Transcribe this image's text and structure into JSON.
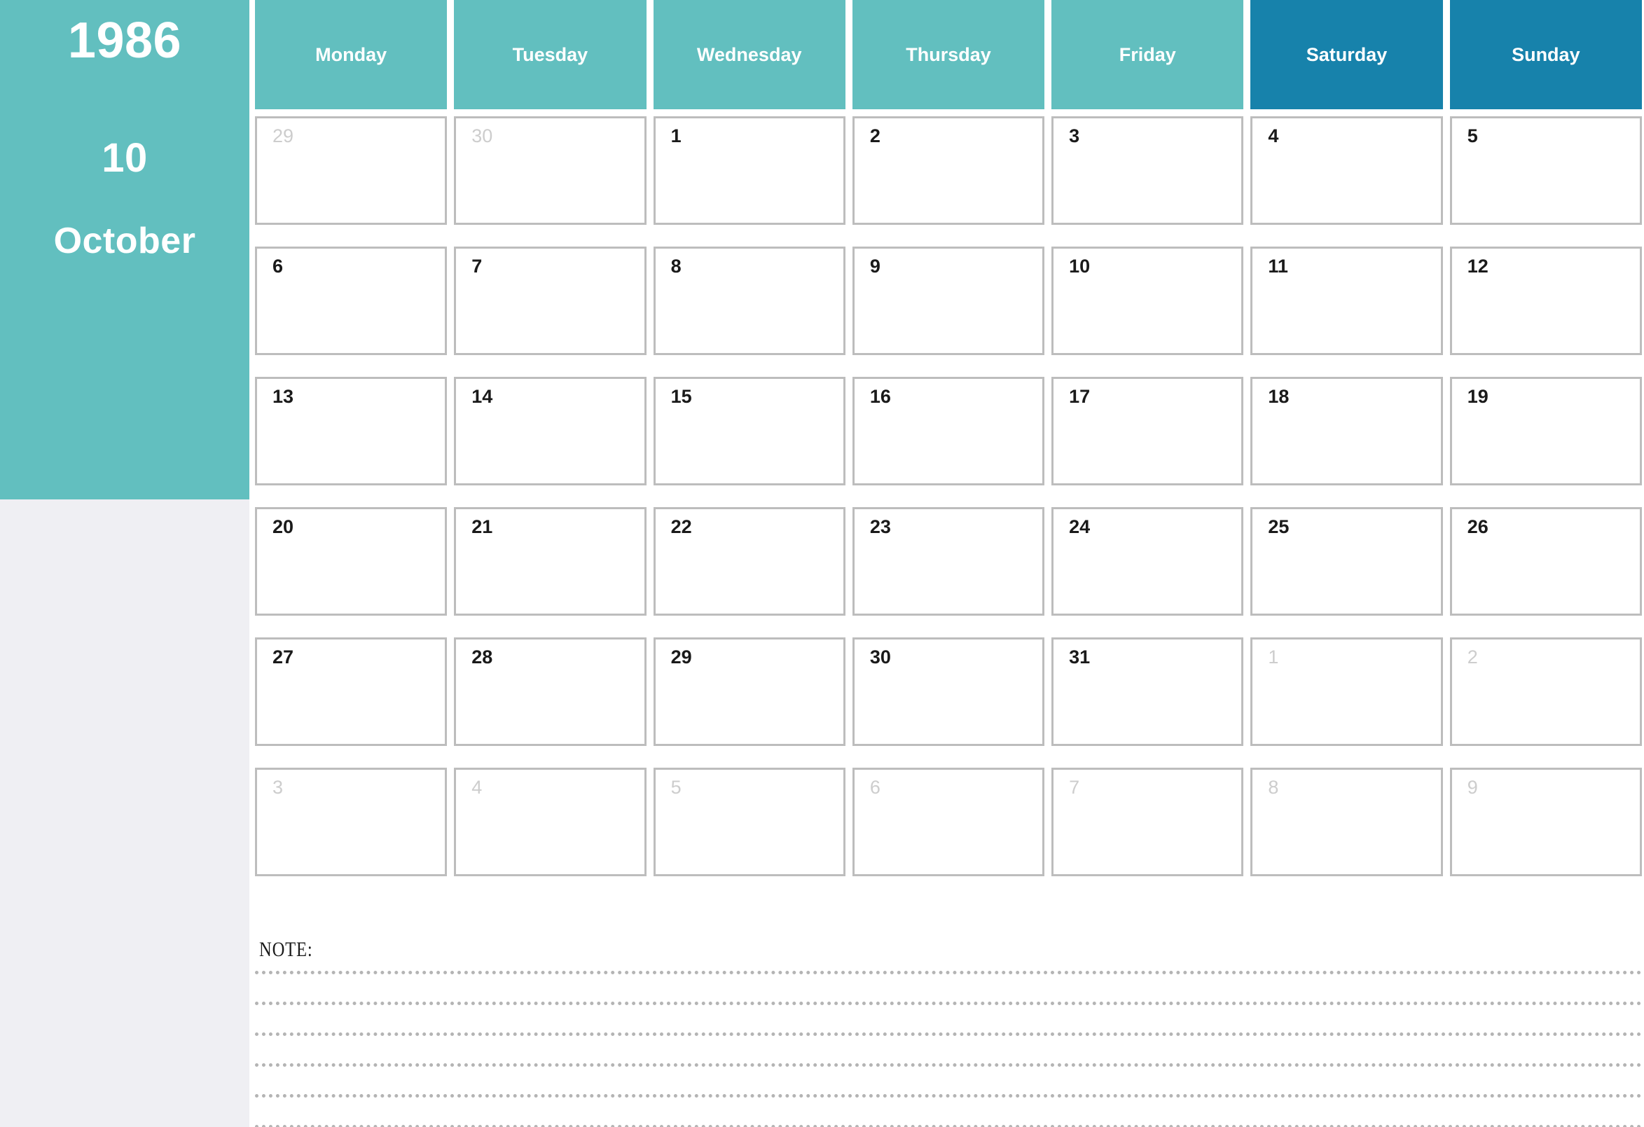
{
  "sidebar": {
    "year": "1986",
    "month_number": "10",
    "month_name": "October",
    "background_color": "#62BFBF",
    "lower_background_color": "#EFEFF3",
    "text_color": "#FFFFFF"
  },
  "colors": {
    "weekday_header": "#62BFBF",
    "weekend_header": "#1782AB",
    "cell_border": "#BDBDBD",
    "current_month_number": "#1A1A1A",
    "other_month_number": "#CDCDCD",
    "note_line": "#B4B4B4"
  },
  "weekdays": [
    {
      "label": "Monday",
      "weekend": false
    },
    {
      "label": "Tuesday",
      "weekend": false
    },
    {
      "label": "Wednesday",
      "weekend": false
    },
    {
      "label": "Thursday",
      "weekend": false
    },
    {
      "label": "Friday",
      "weekend": false
    },
    {
      "label": "Saturday",
      "weekend": true
    },
    {
      "label": "Sunday",
      "weekend": true
    }
  ],
  "weeks": [
    [
      {
        "day": "29",
        "in_month": false
      },
      {
        "day": "30",
        "in_month": false
      },
      {
        "day": "1",
        "in_month": true
      },
      {
        "day": "2",
        "in_month": true
      },
      {
        "day": "3",
        "in_month": true
      },
      {
        "day": "4",
        "in_month": true
      },
      {
        "day": "5",
        "in_month": true
      }
    ],
    [
      {
        "day": "6",
        "in_month": true
      },
      {
        "day": "7",
        "in_month": true
      },
      {
        "day": "8",
        "in_month": true
      },
      {
        "day": "9",
        "in_month": true
      },
      {
        "day": "10",
        "in_month": true
      },
      {
        "day": "11",
        "in_month": true
      },
      {
        "day": "12",
        "in_month": true
      }
    ],
    [
      {
        "day": "13",
        "in_month": true
      },
      {
        "day": "14",
        "in_month": true
      },
      {
        "day": "15",
        "in_month": true
      },
      {
        "day": "16",
        "in_month": true
      },
      {
        "day": "17",
        "in_month": true
      },
      {
        "day": "18",
        "in_month": true
      },
      {
        "day": "19",
        "in_month": true
      }
    ],
    [
      {
        "day": "20",
        "in_month": true
      },
      {
        "day": "21",
        "in_month": true
      },
      {
        "day": "22",
        "in_month": true
      },
      {
        "day": "23",
        "in_month": true
      },
      {
        "day": "24",
        "in_month": true
      },
      {
        "day": "25",
        "in_month": true
      },
      {
        "day": "26",
        "in_month": true
      }
    ],
    [
      {
        "day": "27",
        "in_month": true
      },
      {
        "day": "28",
        "in_month": true
      },
      {
        "day": "29",
        "in_month": true
      },
      {
        "day": "30",
        "in_month": true
      },
      {
        "day": "31",
        "in_month": true
      },
      {
        "day": "1",
        "in_month": false
      },
      {
        "day": "2",
        "in_month": false
      }
    ],
    [
      {
        "day": "3",
        "in_month": false
      },
      {
        "day": "4",
        "in_month": false
      },
      {
        "day": "5",
        "in_month": false
      },
      {
        "day": "6",
        "in_month": false
      },
      {
        "day": "7",
        "in_month": false
      },
      {
        "day": "8",
        "in_month": false
      },
      {
        "day": "9",
        "in_month": false
      }
    ]
  ],
  "note": {
    "label": "NOTE:",
    "line_count": 6
  }
}
